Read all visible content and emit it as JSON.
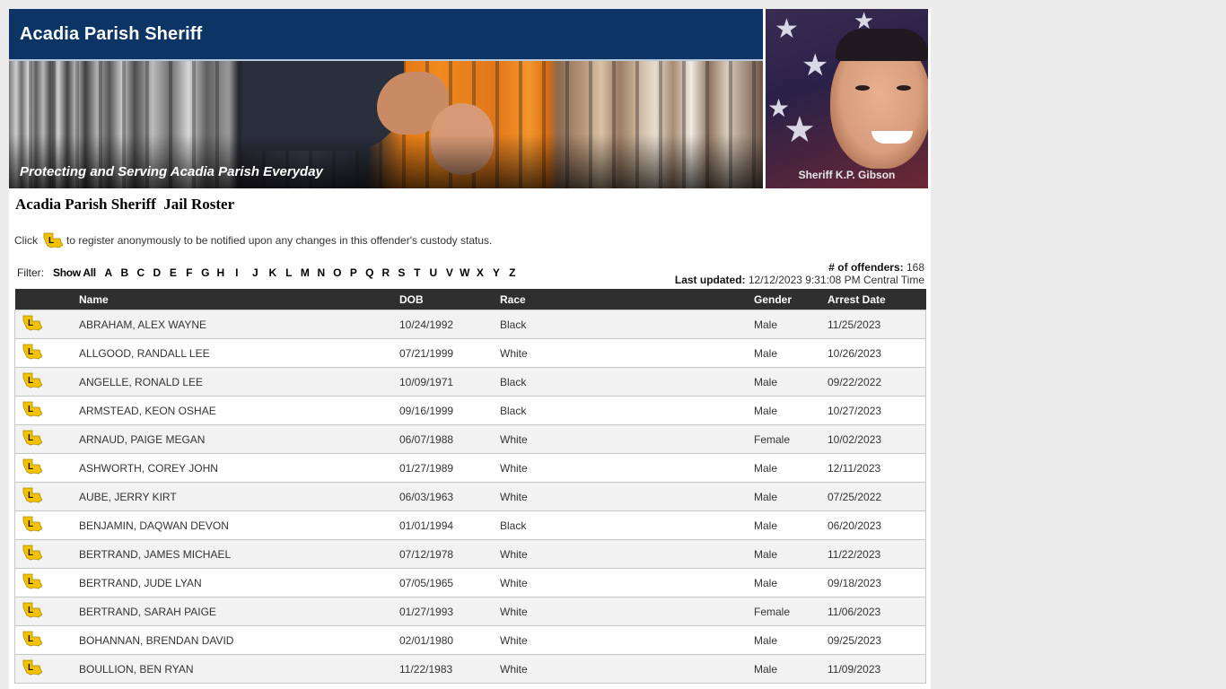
{
  "header": {
    "site_title": "Acadia Parish Sheriff",
    "tagline": "Protecting and Serving Acadia Parish Everyday",
    "sheriff_name": "Sheriff K.P. Gibson"
  },
  "page": {
    "title": "Acadia Parish Sheriff  Jail Roster",
    "notice_before": "Click",
    "notice_after": "to register anonymously to be notified upon any changes in this offender's custody status."
  },
  "filter": {
    "label": "Filter:",
    "show_all": "Show All",
    "letters": [
      "A",
      "B",
      "C",
      "D",
      "E",
      "F",
      "G",
      "H",
      "I",
      "J",
      "K",
      "L",
      "M",
      "N",
      "O",
      "P",
      "Q",
      "R",
      "S",
      "T",
      "U",
      "V",
      "W",
      "X",
      "Y",
      "Z"
    ]
  },
  "stats": {
    "offenders_label": "# of offenders:",
    "offenders_count": "168",
    "updated_label": "Last updated:",
    "updated_value": "12/12/2023 9:31:08 PM Central Time"
  },
  "table": {
    "headers": {
      "name": "Name",
      "dob": "DOB",
      "race": "Race",
      "gender": "Gender",
      "arrest_date": "Arrest Date"
    },
    "rows": [
      {
        "name": "ABRAHAM, ALEX WAYNE",
        "dob": "10/24/1992",
        "race": "Black",
        "gender": "Male",
        "arrest_date": "11/25/2023"
      },
      {
        "name": "ALLGOOD, RANDALL LEE",
        "dob": "07/21/1999",
        "race": "White",
        "gender": "Male",
        "arrest_date": "10/26/2023"
      },
      {
        "name": "ANGELLE, RONALD LEE",
        "dob": "10/09/1971",
        "race": "Black",
        "gender": "Male",
        "arrest_date": "09/22/2022"
      },
      {
        "name": "ARMSTEAD, KEON OSHAE",
        "dob": "09/16/1999",
        "race": "Black",
        "gender": "Male",
        "arrest_date": "10/27/2023"
      },
      {
        "name": "ARNAUD, PAIGE MEGAN",
        "dob": "06/07/1988",
        "race": "White",
        "gender": "Female",
        "arrest_date": "10/02/2023"
      },
      {
        "name": "ASHWORTH, COREY JOHN",
        "dob": "01/27/1989",
        "race": "White",
        "gender": "Male",
        "arrest_date": "12/11/2023"
      },
      {
        "name": "AUBE, JERRY KIRT",
        "dob": "06/03/1963",
        "race": "White",
        "gender": "Male",
        "arrest_date": "07/25/2022"
      },
      {
        "name": "BENJAMIN, DAQWAN DEVON",
        "dob": "01/01/1994",
        "race": "Black",
        "gender": "Male",
        "arrest_date": "06/20/2023"
      },
      {
        "name": "BERTRAND, JAMES MICHAEL",
        "dob": "07/12/1978",
        "race": "White",
        "gender": "Male",
        "arrest_date": "11/22/2023"
      },
      {
        "name": "BERTRAND, JUDE LYAN",
        "dob": "07/05/1965",
        "race": "White",
        "gender": "Male",
        "arrest_date": "09/18/2023"
      },
      {
        "name": "BERTRAND, SARAH PAIGE",
        "dob": "01/27/1993",
        "race": "White",
        "gender": "Female",
        "arrest_date": "11/06/2023"
      },
      {
        "name": "BOHANNAN, BRENDAN DAVID",
        "dob": "02/01/1980",
        "race": "White",
        "gender": "Male",
        "arrest_date": "09/25/2023"
      },
      {
        "name": "BOULLION, BEN RYAN",
        "dob": "11/22/1983",
        "race": "White",
        "gender": "Male",
        "arrest_date": "11/09/2023"
      }
    ]
  },
  "icons": {
    "register": "louisiana-register-icon"
  },
  "colors": {
    "header_bg": "#0c3565",
    "table_header_bg": "#2f2f2f",
    "icon_yellow": "#f2c200"
  }
}
